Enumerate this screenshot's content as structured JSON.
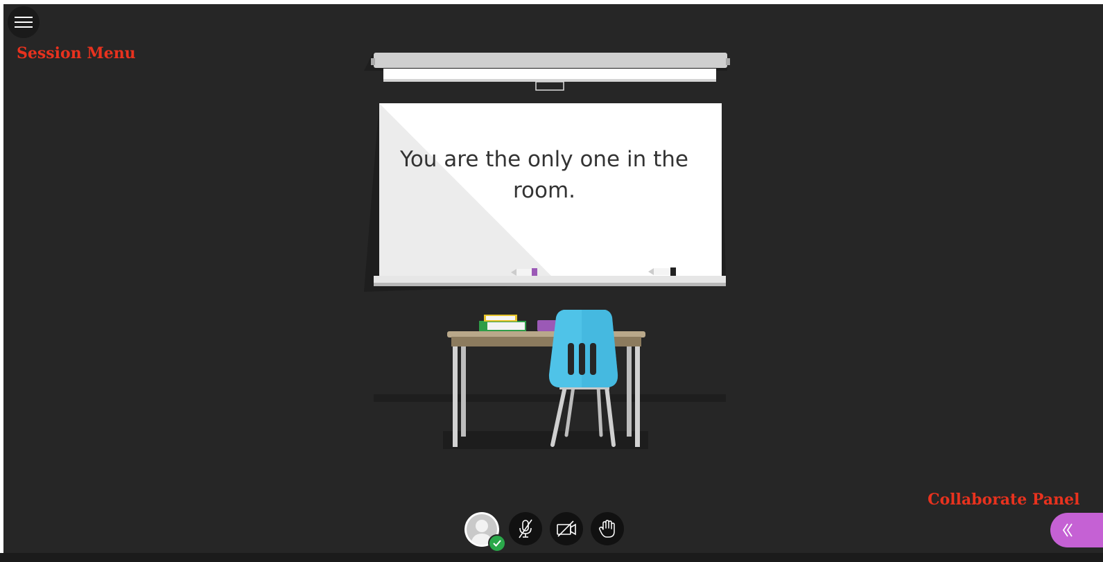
{
  "annotations": {
    "session_menu": "Session Menu",
    "collaborate_panel": "Collaborate Panel"
  },
  "room": {
    "message": "You are the only one in the room."
  },
  "toolbar": {
    "buttons": [
      {
        "name": "avatar",
        "icon": "user-avatar-icon",
        "status": "connected"
      },
      {
        "name": "microphone",
        "icon": "microphone-muted-icon"
      },
      {
        "name": "camera",
        "icon": "camera-off-icon"
      },
      {
        "name": "raise-hand",
        "icon": "hand-icon"
      }
    ]
  },
  "colors": {
    "background": "#262626",
    "annotation": "#e8321e",
    "collaborate_panel": "#c561d4",
    "status_ok": "#2aa84a",
    "chair": "#4fc3e8"
  },
  "icons": {
    "menu": "hamburger-menu-icon",
    "collaborate": "double-chevron-left-icon"
  }
}
